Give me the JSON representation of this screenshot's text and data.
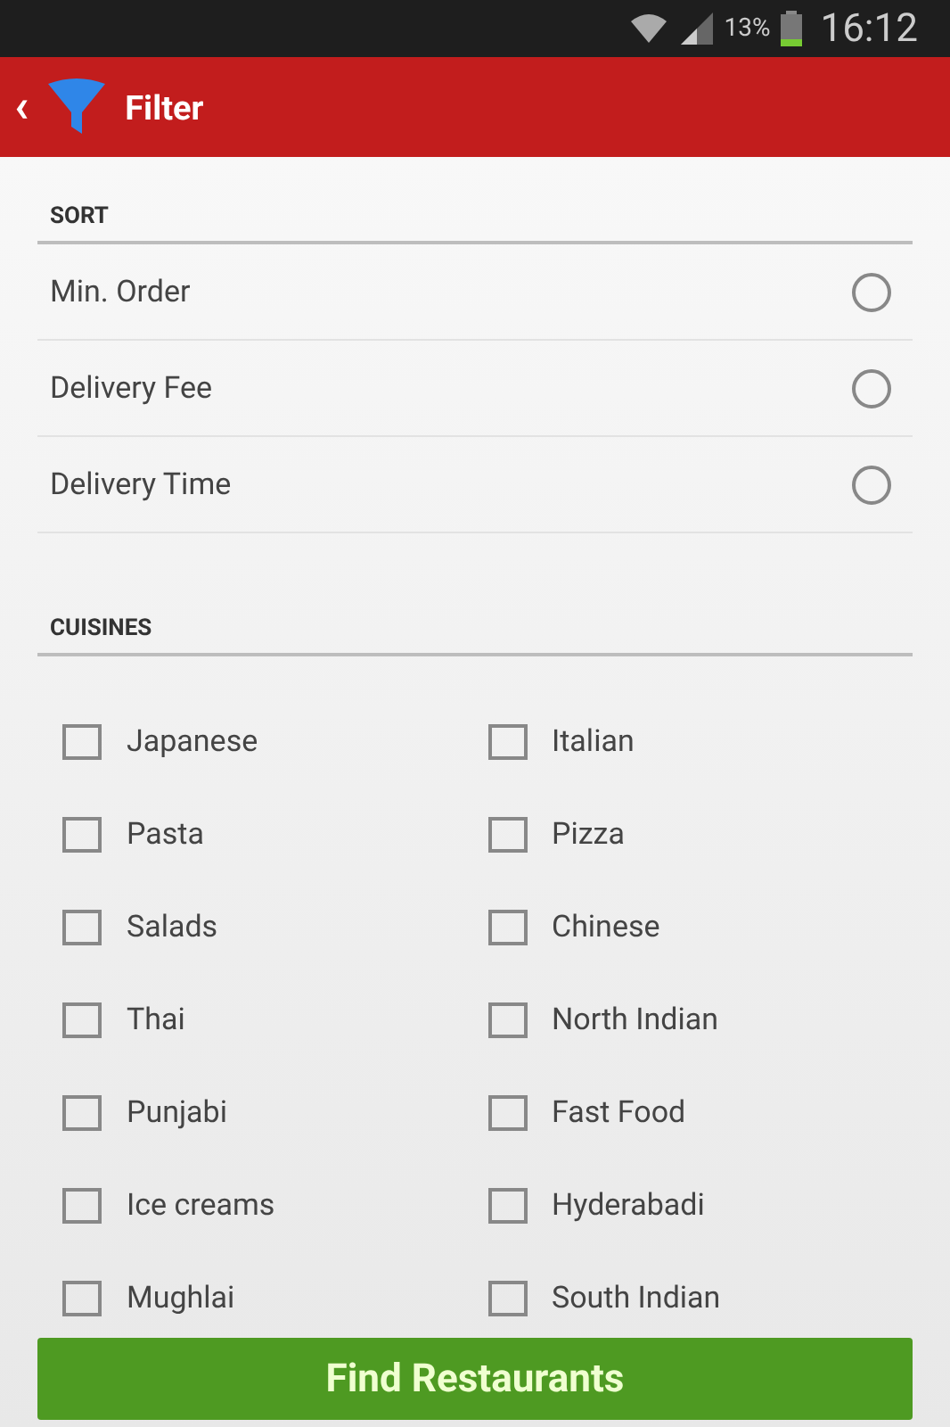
{
  "status_bar": {
    "battery": "13%",
    "time": "16:12"
  },
  "app_bar": {
    "back": "‹",
    "title": "Filter"
  },
  "sort": {
    "heading": "SORT",
    "options": [
      {
        "label": "Min. Order",
        "selected": false
      },
      {
        "label": "Delivery Fee",
        "selected": false
      },
      {
        "label": "Delivery Time",
        "selected": false
      }
    ]
  },
  "cuisines": {
    "heading": "CUISINES",
    "items": [
      {
        "label": "Japanese",
        "checked": false
      },
      {
        "label": "Italian",
        "checked": false
      },
      {
        "label": "Pasta",
        "checked": false
      },
      {
        "label": "Pizza",
        "checked": false
      },
      {
        "label": "Salads",
        "checked": false
      },
      {
        "label": "Chinese",
        "checked": false
      },
      {
        "label": "Thai",
        "checked": false
      },
      {
        "label": "North Indian",
        "checked": false
      },
      {
        "label": "Punjabi",
        "checked": false
      },
      {
        "label": "Fast Food",
        "checked": false
      },
      {
        "label": "Ice creams",
        "checked": false
      },
      {
        "label": "Hyderabadi",
        "checked": false
      },
      {
        "label": "Mughlai",
        "checked": false
      },
      {
        "label": "South Indian",
        "checked": false
      }
    ]
  },
  "button": "Find Restaurants"
}
